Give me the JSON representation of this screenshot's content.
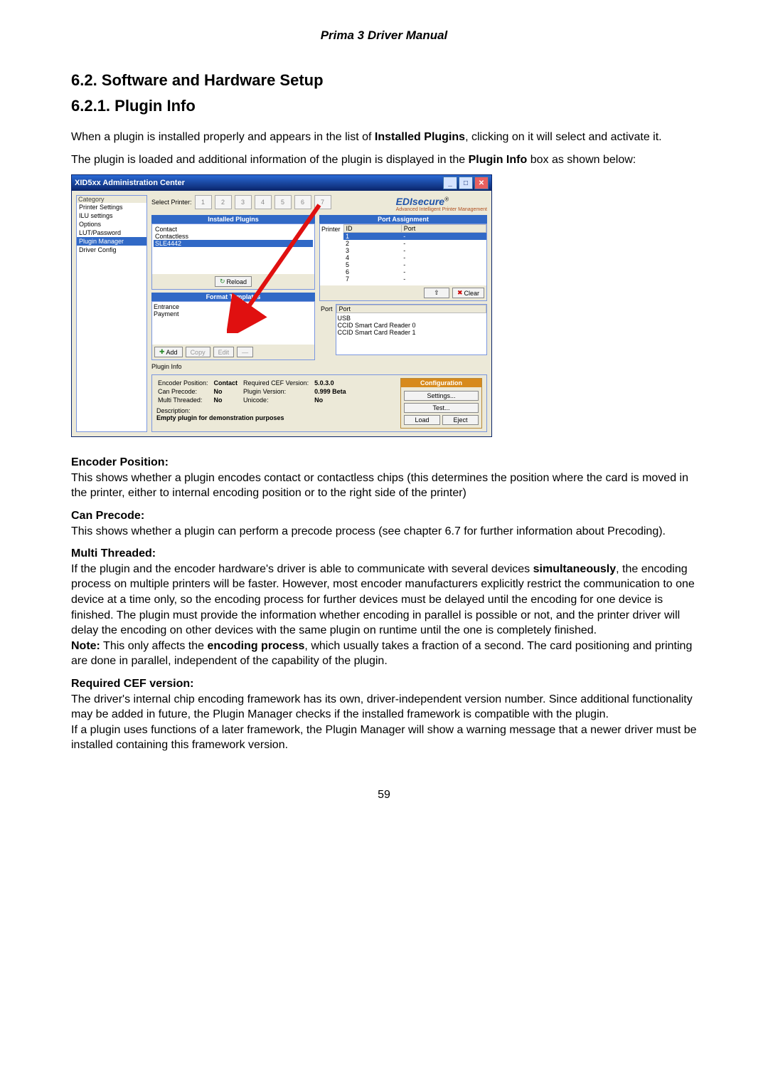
{
  "page_header": "Prima 3 Driver Manual",
  "section_num_title": "6.2.   Software and Hardware Setup",
  "subsection_title": "6.2.1. Plugin Info",
  "intro_p1_a": "When a plugin is installed properly and appears in the list of ",
  "intro_p1_bold": "Installed Plugins",
  "intro_p1_b": ", clicking on it will select and activate it.",
  "intro_p2_a": "The plugin is loaded and additional information of the plugin is displayed in the ",
  "intro_p2_bold": "Plugin Info",
  "intro_p2_b": " box as shown below:",
  "win": {
    "title": "XID5xx Administration Center",
    "category_label": "Category",
    "categories": [
      "Printer Settings",
      "ILU settings",
      "Options",
      "LUT/Password",
      "Plugin Manager",
      "Driver Config"
    ],
    "select_printer_label": "Select Printer:",
    "printer_buttons": [
      "1",
      "2",
      "3",
      "4",
      "5",
      "6",
      "7"
    ],
    "brand_a": "EDI",
    "brand_b": "secure",
    "brand_reg": "®",
    "brand_sub": "Advanced Intelligent\nPrinter Management",
    "installed_plugins_head": "Installed Plugins",
    "plugins": [
      "Contact",
      "Contactless",
      "SLE4442"
    ],
    "reload_btn": "Reload",
    "format_templates_head": "Format Templates",
    "templates": [
      "Entrance",
      "Payment"
    ],
    "tmpl_add": "Add",
    "tmpl_copy": "Copy",
    "tmpl_edit": "Edit",
    "tmpl_del": "—",
    "port_assign_head": "Port Assignment",
    "pa_printer": "Printer",
    "pa_id": "ID",
    "pa_port": "Port",
    "pa_rows": [
      "1",
      "2",
      "3",
      "4",
      "5",
      "6",
      "7"
    ],
    "clear_btn": "Clear",
    "port_label": "Port",
    "port_col": "Port",
    "port_rows": [
      "USB",
      "CCID Smart Card Reader 0",
      "CCID Smart Card Reader 1"
    ],
    "plugin_info_label": "Plugin Info",
    "pi_enc_pos_l": "Encoder Position:",
    "pi_enc_pos_v": "Contact",
    "pi_can_pre_l": "Can Precode:",
    "pi_can_pre_v": "No",
    "pi_multi_l": "Multi Threaded:",
    "pi_multi_v": "No",
    "pi_reqcef_l": "Required CEF Version:",
    "pi_reqcef_v": "5.0.3.0",
    "pi_plugver_l": "Plugin Version:",
    "pi_plugver_v": "0.999 Beta",
    "pi_unicode_l": "Unicode:",
    "pi_unicode_v": "No",
    "pi_desc_l": "Description:",
    "pi_desc_v": "Empty plugin for demonstration purposes",
    "cfg_head": "Configuration",
    "cfg_settings": "Settings...",
    "cfg_test": "Test...",
    "cfg_load": "Load",
    "cfg_eject": "Eject"
  },
  "def": {
    "encpos_h": "Encoder Position:",
    "encpos_p": "This shows whether a plugin encodes contact or contactless chips (this determines the position where the card is moved in the printer, either to internal encoding position or to the right side of the printer)",
    "canpre_h": "Can Precode:",
    "canpre_p": "This shows whether a plugin can perform a precode process (see chapter 6.7 for further information about Precoding).",
    "multi_h": "Multi Threaded:",
    "multi_p1": "If the plugin and the encoder hardware's driver is able to communicate with several devices ",
    "multi_bold": "simultaneously",
    "multi_p2": ", the encoding process on multiple printers will be faster. However, most encoder manufacturers explicitly restrict the communication to one device at a time only, so the encoding process for further devices must be delayed until the encoding for one device is finished. The plugin must provide the information whether encoding in parallel is possible or not, and the printer driver will delay the encoding on other devices with the same plugin on runtime until the one is completely finished.",
    "multi_note_a": "Note:",
    "multi_note_b": " This only affects the ",
    "multi_note_bold": "encoding process",
    "multi_note_c": ", which usually takes a fraction of a second. The card positioning and printing are done in parallel, independent of the capability of the plugin.",
    "reqcef_h": "Required CEF version:",
    "reqcef_p1": "The driver's internal chip encoding framework has its own, driver-independent version number. Since additional functionality may be added in future, the Plugin Manager checks if the installed framework is compatible with the plugin.",
    "reqcef_p2": "If a plugin uses functions of a later framework, the Plugin Manager will show a warning message that a newer driver must be installed containing this framework version."
  },
  "page_number": "59"
}
